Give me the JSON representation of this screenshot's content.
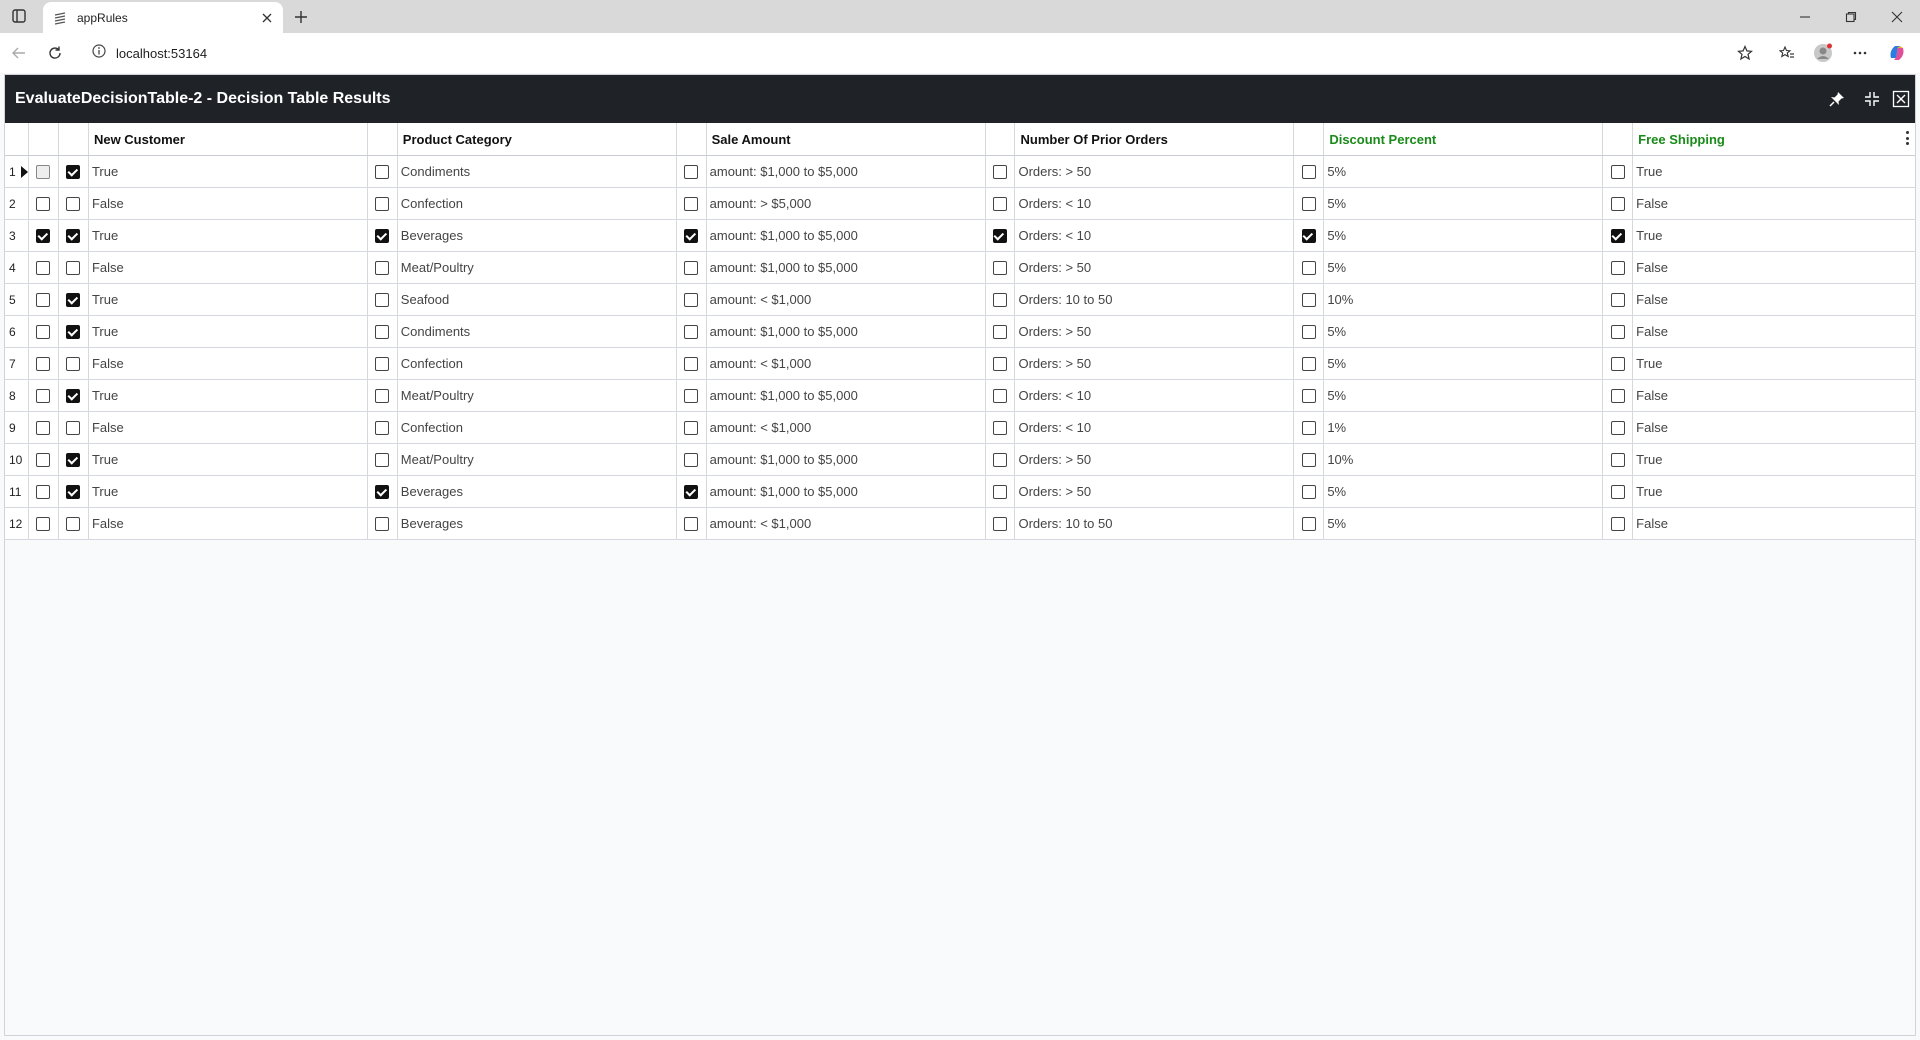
{
  "browser": {
    "tab_title": "appRules",
    "url": "localhost:53164"
  },
  "app": {
    "title": "EvaluateDecisionTable-2 - Decision Table Results"
  },
  "grid": {
    "columns": [
      {
        "label": "New Customer",
        "color": "#111111"
      },
      {
        "label": "Product Category",
        "color": "#111111"
      },
      {
        "label": "Sale Amount",
        "color": "#111111"
      },
      {
        "label": "Number Of Prior Orders",
        "color": "#111111"
      },
      {
        "label": "Discount Percent",
        "color": "#1a8a1a"
      },
      {
        "label": "Free Shipping",
        "color": "#1a8a1a"
      }
    ],
    "rows": [
      {
        "num": "1",
        "sel": false,
        "checks": [
          true,
          false,
          false,
          false,
          false,
          false
        ],
        "values": [
          "True",
          "Condiments",
          "amount: $1,000 to $5,000",
          "Orders: > 50",
          "5%",
          "True"
        ]
      },
      {
        "num": "2",
        "sel": false,
        "checks": [
          false,
          false,
          false,
          false,
          false,
          false
        ],
        "values": [
          "False",
          "Confection",
          "amount: > $5,000",
          "Orders: < 10",
          "5%",
          "False"
        ]
      },
      {
        "num": "3",
        "sel": true,
        "checks": [
          true,
          true,
          true,
          true,
          true,
          true
        ],
        "values": [
          "True",
          "Beverages",
          "amount: $1,000 to $5,000",
          "Orders: < 10",
          "5%",
          "True"
        ]
      },
      {
        "num": "4",
        "sel": false,
        "checks": [
          false,
          false,
          false,
          false,
          false,
          false
        ],
        "values": [
          "False",
          "Meat/Poultry",
          "amount: $1,000 to $5,000",
          "Orders: > 50",
          "5%",
          "False"
        ]
      },
      {
        "num": "5",
        "sel": false,
        "checks": [
          true,
          false,
          false,
          false,
          false,
          false
        ],
        "values": [
          "True",
          "Seafood",
          "amount: < $1,000",
          "Orders: 10 to 50",
          "10%",
          "False"
        ]
      },
      {
        "num": "6",
        "sel": false,
        "checks": [
          true,
          false,
          false,
          false,
          false,
          false
        ],
        "values": [
          "True",
          "Condiments",
          "amount: $1,000 to $5,000",
          "Orders: > 50",
          "5%",
          "False"
        ]
      },
      {
        "num": "7",
        "sel": false,
        "checks": [
          false,
          false,
          false,
          false,
          false,
          false
        ],
        "values": [
          "False",
          "Confection",
          "amount: < $1,000",
          "Orders: > 50",
          "5%",
          "True"
        ]
      },
      {
        "num": "8",
        "sel": false,
        "checks": [
          true,
          false,
          false,
          false,
          false,
          false
        ],
        "values": [
          "True",
          "Meat/Poultry",
          "amount: $1,000 to $5,000",
          "Orders: < 10",
          "5%",
          "False"
        ]
      },
      {
        "num": "9",
        "sel": false,
        "checks": [
          false,
          false,
          false,
          false,
          false,
          false
        ],
        "values": [
          "False",
          "Confection",
          "amount: < $1,000",
          "Orders: < 10",
          "1%",
          "False"
        ]
      },
      {
        "num": "10",
        "sel": false,
        "checks": [
          true,
          false,
          false,
          false,
          false,
          false
        ],
        "values": [
          "True",
          "Meat/Poultry",
          "amount: $1,000 to $5,000",
          "Orders: > 50",
          "10%",
          "True"
        ]
      },
      {
        "num": "11",
        "sel": false,
        "checks": [
          true,
          true,
          true,
          false,
          false,
          false
        ],
        "values": [
          "True",
          "Beverages",
          "amount: $1,000 to $5,000",
          "Orders: > 50",
          "5%",
          "True"
        ]
      },
      {
        "num": "12",
        "sel": false,
        "checks": [
          false,
          false,
          false,
          false,
          false,
          false
        ],
        "values": [
          "False",
          "Beverages",
          "amount: < $1,000",
          "Orders: 10 to 50",
          "5%",
          "False"
        ]
      }
    ]
  }
}
